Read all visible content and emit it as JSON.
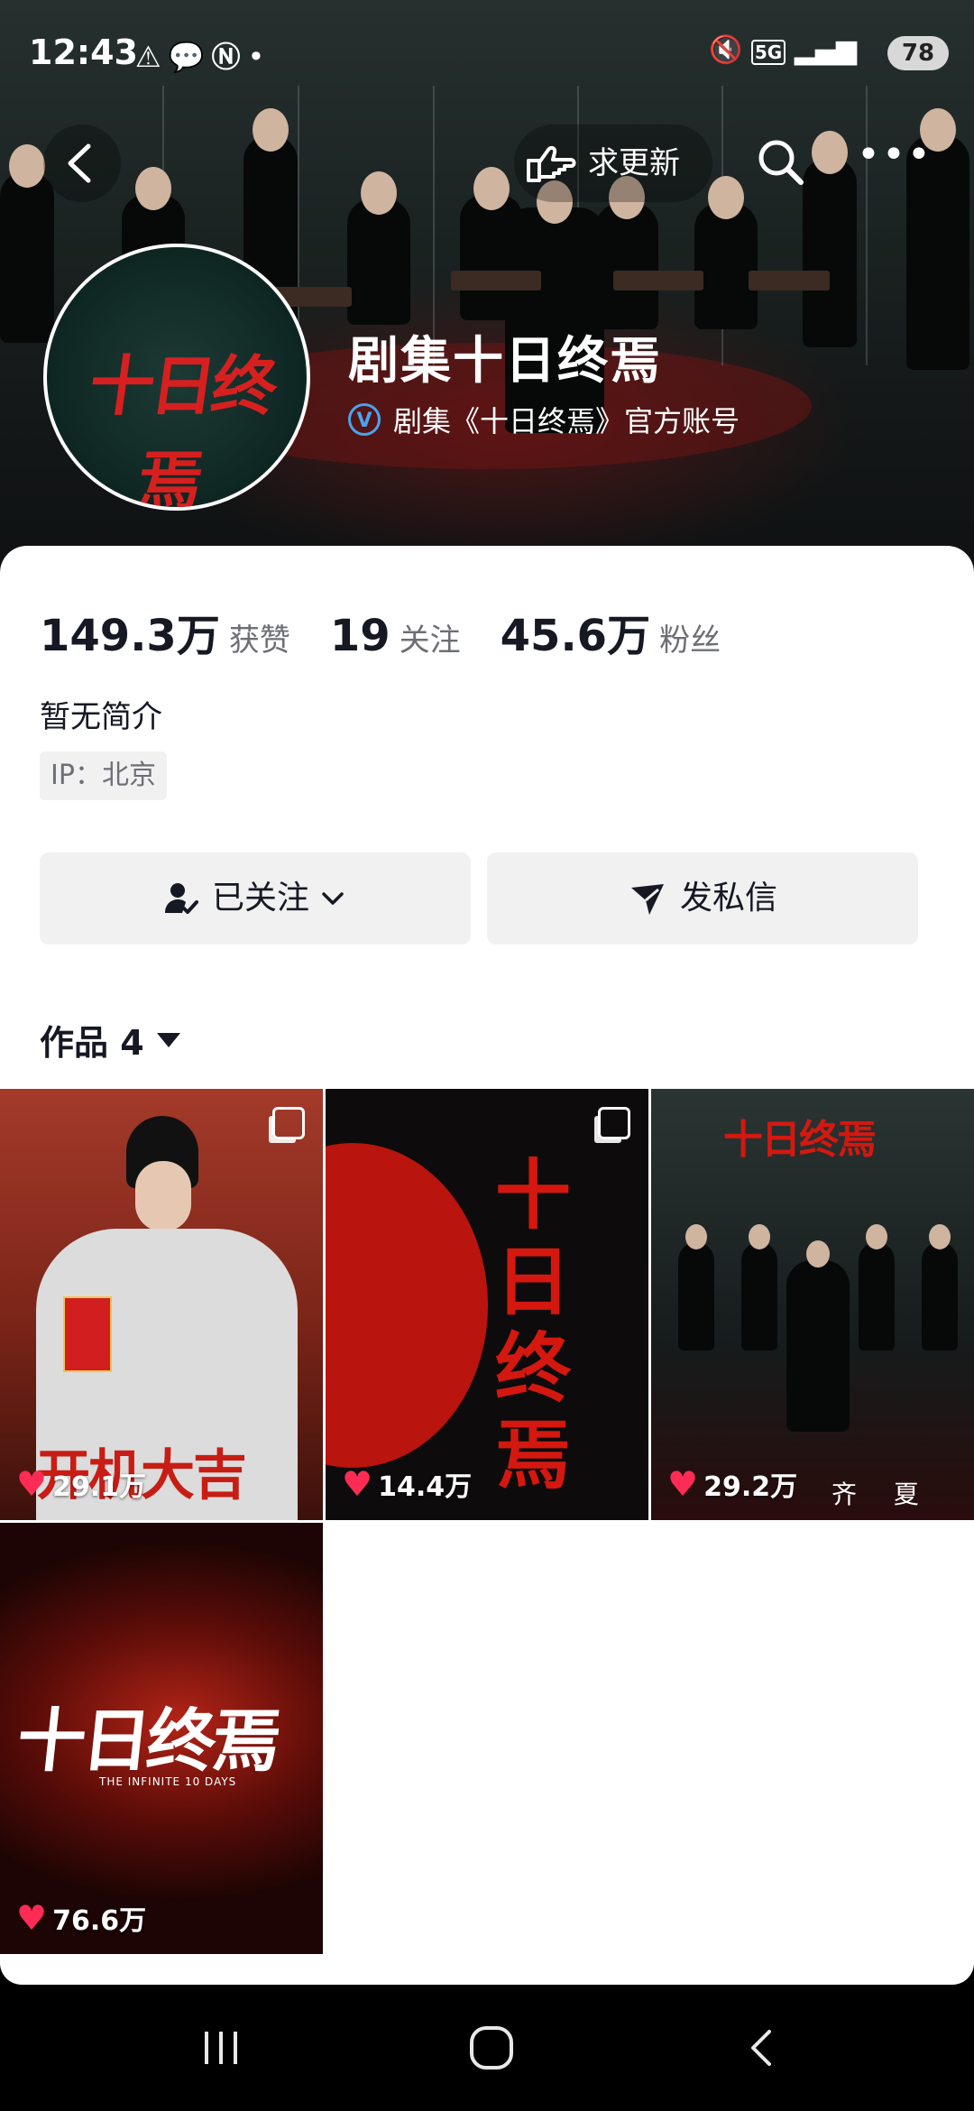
{
  "status_bar": {
    "time": "12:43",
    "left_icons": [
      "warning-icon",
      "chat-bubble-icon",
      "nfc-icon",
      "dot-icon"
    ],
    "right_icons": [
      "mute-icon",
      "5g-icon",
      "signal-icon"
    ],
    "battery": "78"
  },
  "nav": {
    "request_update_label": "求更新"
  },
  "profile": {
    "avatar_logo_text": "十日终焉",
    "name": "剧集十日终焉",
    "verified_text": "剧集《十日终焉》官方账号",
    "verified_badge": "V"
  },
  "stats": [
    {
      "value": "149.3万",
      "label": "获赞"
    },
    {
      "value": "19",
      "label": "关注"
    },
    {
      "value": "45.6万",
      "label": "粉丝"
    }
  ],
  "bio": "暂无简介",
  "ip": "IP：北京",
  "actions": {
    "follow_label": "已关注",
    "message_label": "发私信"
  },
  "works": {
    "title": "作品 4",
    "items": [
      {
        "likes": "29.1万",
        "text": "开机大吉",
        "multi_image": true
      },
      {
        "likes": "14.4万",
        "text": "十日终焉",
        "multi_image": true
      },
      {
        "likes": "29.2万",
        "text": "齐 夏",
        "multi_image": false
      },
      {
        "likes": "76.6万",
        "text": "十日终焉",
        "subtitle": "THE INFINITE 10 DAYS",
        "multi_image": false
      }
    ]
  },
  "colors": {
    "accent_heart": "#fe2c55",
    "verify_blue": "#4aa3f0",
    "button_bg": "#f1f1f2",
    "text_primary": "#161823",
    "text_secondary": "#6e6f75"
  }
}
